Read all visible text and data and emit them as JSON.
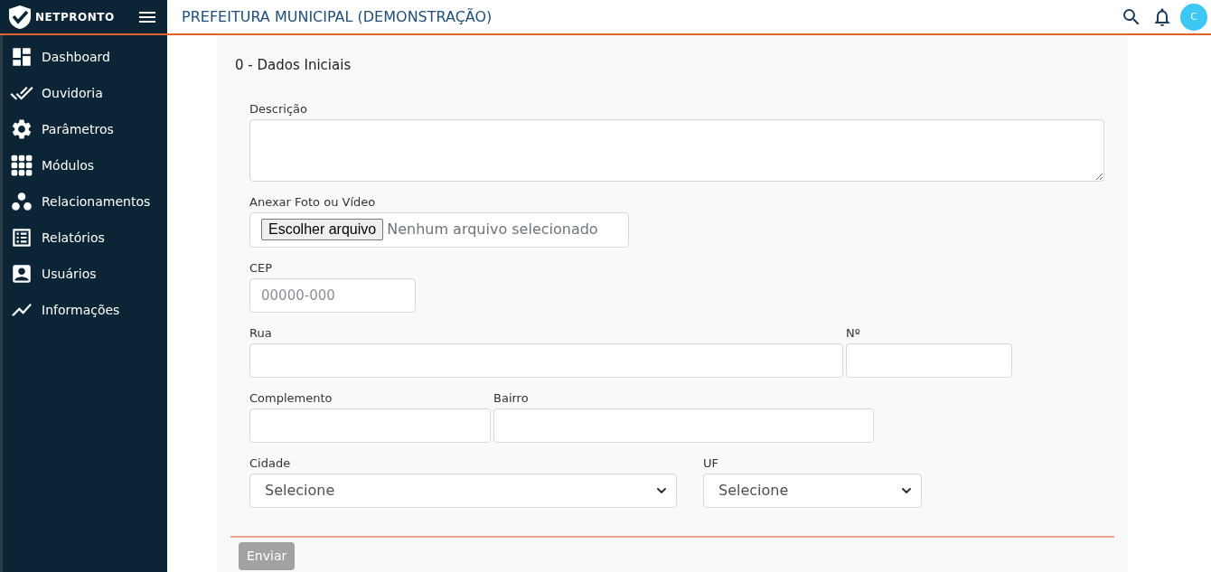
{
  "header": {
    "brand": "NETPRONTO",
    "title": "PREFEITURA MUNICIPAL (DEMONSTRAÇÃO)",
    "avatar": "C"
  },
  "sidebar": {
    "items": [
      {
        "label": "Dashboard"
      },
      {
        "label": "Ouvidoria"
      },
      {
        "label": "Parâmetros"
      },
      {
        "label": "Módulos"
      },
      {
        "label": "Relacionamentos"
      },
      {
        "label": "Relatórios"
      },
      {
        "label": "Usuários"
      },
      {
        "label": "Informações"
      }
    ]
  },
  "form": {
    "section_title": "0 - Dados Iniciais",
    "rows": [
      [
        {
          "kind": "textarea",
          "label": "Descrição"
        }
      ],
      [
        {
          "kind": "file",
          "label": "Anexar Foto ou Vídeo",
          "button": "Escolher arquivo",
          "value": "Nenhum arquivo selecionado"
        }
      ],
      [
        {
          "kind": "text",
          "label": "CEP",
          "placeholder": "00000-000"
        }
      ],
      [
        {
          "kind": "text",
          "label": "Rua"
        },
        {
          "kind": "text",
          "label": "Nº"
        }
      ],
      [
        {
          "kind": "text",
          "label": "Complemento"
        },
        {
          "kind": "text",
          "label": "Bairro"
        }
      ],
      [
        {
          "kind": "select",
          "label": "Cidade",
          "value": "Selecione"
        },
        {
          "kind": "select",
          "label": "UF",
          "value": "Selecione"
        }
      ]
    ],
    "submit": {
      "label": "Enviar",
      "disabled": true
    }
  }
}
